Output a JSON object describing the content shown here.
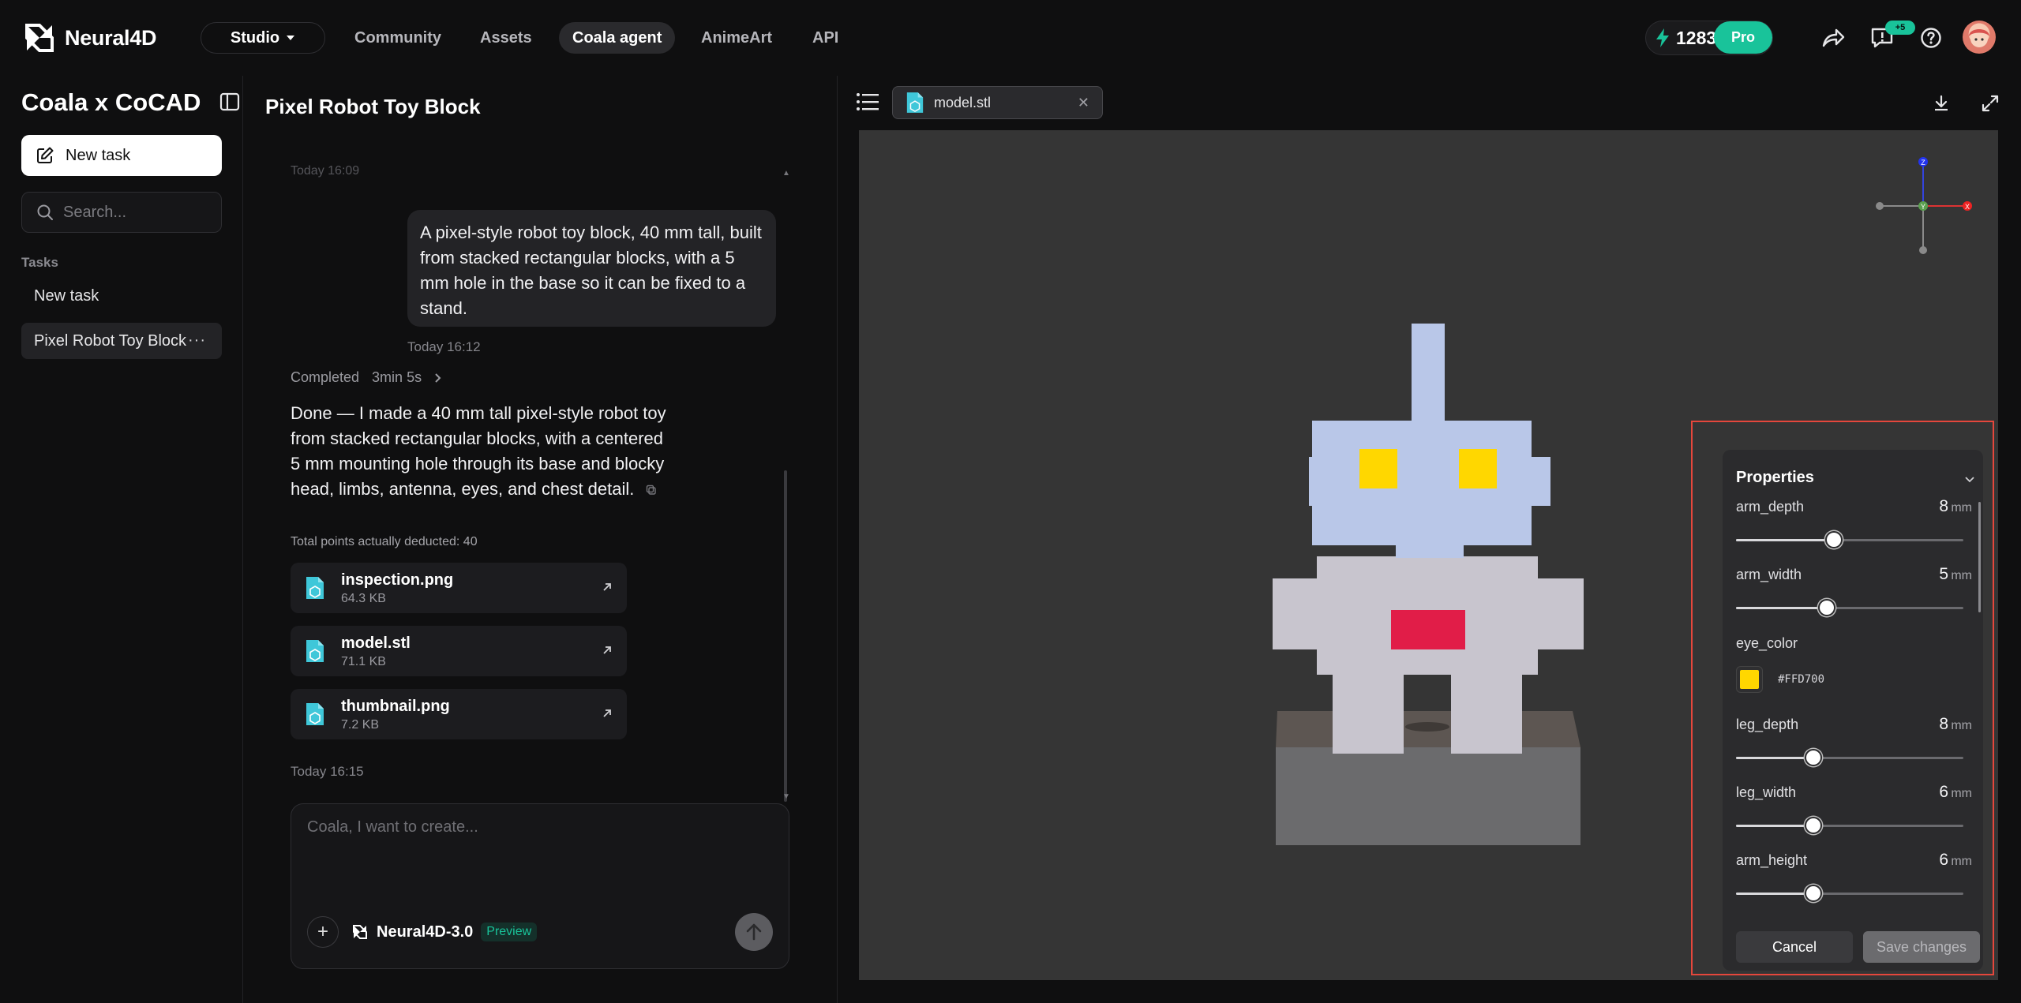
{
  "brand": {
    "name": "Neural4D"
  },
  "nav": {
    "studio_label": "Studio",
    "items": [
      {
        "label": "Community"
      },
      {
        "label": "Assets"
      },
      {
        "label": "Coala agent",
        "active": true
      },
      {
        "label": "AnimeArt"
      },
      {
        "label": "API"
      }
    ]
  },
  "account": {
    "credits": "12834",
    "plan": "Pro",
    "notif_badge": "+5"
  },
  "sidebar": {
    "title": "Coala x CoCAD",
    "new_task_label": "New task",
    "search_placeholder": "Search...",
    "section_label": "Tasks",
    "items": [
      {
        "label": "New task"
      },
      {
        "label": "Pixel Robot Toy Block",
        "active": true
      }
    ]
  },
  "chat": {
    "title": "Pixel Robot Toy Block",
    "faded_timestamp": "Today 16:09",
    "user_message": "A pixel-style robot toy block, 40 mm tall, built from stacked rectangular blocks, with a 5 mm hole in the base so it can be fixed to a stand.",
    "user_timestamp": "Today 16:12",
    "status_label": "Completed",
    "status_duration": "3min 5s",
    "assistant_message": "Done — I made a 40 mm tall pixel-style robot toy from stacked rectangular blocks, with a centered 5 mm mounting hole through its base and blocky head, limbs, antenna, eyes, and chest detail.",
    "points_note": "Total points actually deducted: 40",
    "files": [
      {
        "name": "inspection.png",
        "size": "64.3 KB"
      },
      {
        "name": "model.stl",
        "size": "71.1 KB"
      },
      {
        "name": "thumbnail.png",
        "size": "7.2 KB"
      }
    ],
    "assistant_timestamp": "Today 16:15",
    "composer_placeholder": "Coala, I want to create...",
    "model_name": "Neural4D-3.0",
    "model_tag": "Preview"
  },
  "viewer": {
    "tab_label": "model.stl",
    "gizmo": {
      "z": "Z",
      "x": "X",
      "y": "Y"
    },
    "colors": {
      "head": "#b9c7e8",
      "body": "#c8c5ce",
      "eyes": "#FFD700",
      "chest": "#e11d48",
      "base_top": "#5d5652",
      "base_front": "#6b6b6d",
      "background": "#353535"
    }
  },
  "properties": {
    "title": "Properties",
    "params": [
      {
        "name": "arm_depth",
        "value": "8",
        "unit": "mm",
        "fraction": 0.43
      },
      {
        "name": "arm_width",
        "value": "5",
        "unit": "mm",
        "fraction": 0.4
      },
      {
        "name": "eye_color",
        "color": "#FFD700",
        "hex": "#FFD700"
      },
      {
        "name": "leg_depth",
        "value": "8",
        "unit": "mm",
        "fraction": 0.34
      },
      {
        "name": "leg_width",
        "value": "6",
        "unit": "mm",
        "fraction": 0.34
      },
      {
        "name": "arm_height",
        "value": "6",
        "unit": "mm",
        "fraction": 0.34
      }
    ],
    "cancel_label": "Cancel",
    "save_label": "Save changes"
  }
}
